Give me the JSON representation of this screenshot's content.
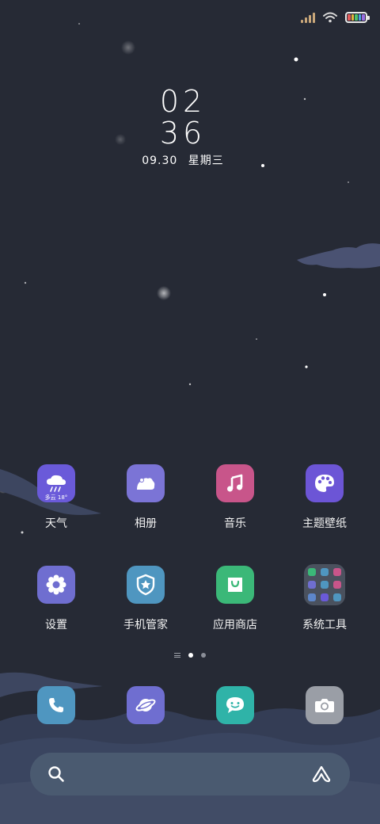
{
  "status_bar": {
    "signal_icon": "cell-signal-icon",
    "wifi_icon": "wifi-icon",
    "battery_icon": "battery-icon",
    "signal_color": "#c9a77a",
    "battery_colors": [
      "#e25b5b",
      "#e2b73f",
      "#4fc36b",
      "#4fa3e2",
      "#9a6ee2"
    ]
  },
  "clock": {
    "hour": "02",
    "minute": "36",
    "date": "09.30",
    "weekday": "星期三"
  },
  "apps": [
    {
      "label": "天气",
      "icon": "weather-icon",
      "color": "#6a5ad9",
      "sub": "多云 18°"
    },
    {
      "label": "相册",
      "icon": "gallery-icon",
      "color": "#7b74d6"
    },
    {
      "label": "音乐",
      "icon": "music-icon",
      "color": "#c8558a"
    },
    {
      "label": "主题壁纸",
      "icon": "palette-icon",
      "color": "#6c55d6"
    },
    {
      "label": "设置",
      "icon": "gear-icon",
      "color": "#6f6ed0"
    },
    {
      "label": "手机管家",
      "icon": "shield-icon",
      "color": "#4f96c0"
    },
    {
      "label": "应用商店",
      "icon": "shopping-bag-icon",
      "color": "#3bb878"
    },
    {
      "label": "系统工具",
      "icon": "folder-icon",
      "color": "#787f91"
    }
  ],
  "folder_colors": [
    "#3bb878",
    "#4f96c0",
    "#c8558a",
    "#6f6ed0",
    "#4f96c0",
    "#c8558a",
    "#5d86c9",
    "#6a5ad9",
    "#4f96c0"
  ],
  "dock": [
    {
      "icon": "phone-icon",
      "color": "#4f96c0"
    },
    {
      "icon": "browser-planet-icon",
      "color": "#6f6ed0"
    },
    {
      "icon": "message-icon",
      "color": "#2fb3a8"
    },
    {
      "icon": "camera-icon",
      "color": "#9a9ea6"
    }
  ],
  "search": {
    "search_icon": "search-icon",
    "assistant_icon": "assistant-icon"
  }
}
